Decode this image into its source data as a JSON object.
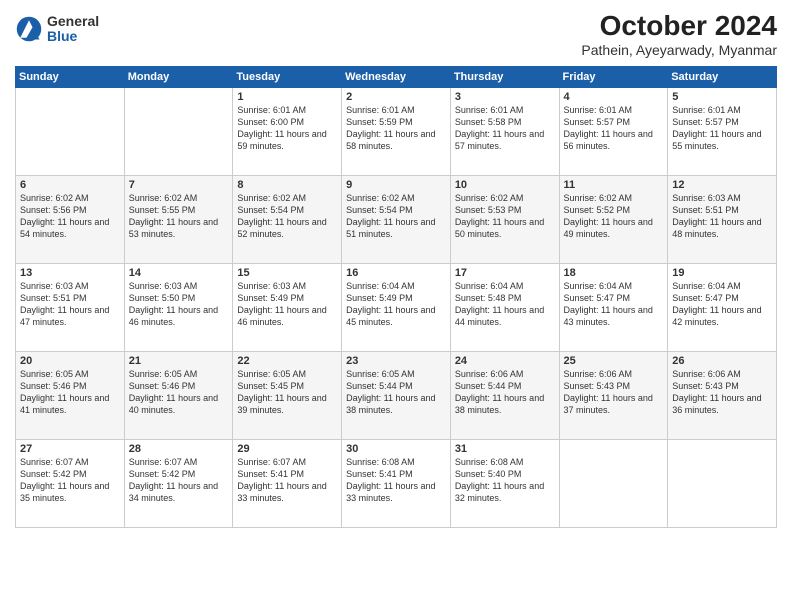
{
  "header": {
    "logo": {
      "general": "General",
      "blue": "Blue"
    },
    "title": "October 2024",
    "subtitle": "Pathein, Ayeyarwady, Myanmar"
  },
  "weekdays": [
    "Sunday",
    "Monday",
    "Tuesday",
    "Wednesday",
    "Thursday",
    "Friday",
    "Saturday"
  ],
  "weeks": [
    [
      {
        "day": "",
        "info": ""
      },
      {
        "day": "",
        "info": ""
      },
      {
        "day": "1",
        "info": "Sunrise: 6:01 AM\nSunset: 6:00 PM\nDaylight: 11 hours and 59 minutes."
      },
      {
        "day": "2",
        "info": "Sunrise: 6:01 AM\nSunset: 5:59 PM\nDaylight: 11 hours and 58 minutes."
      },
      {
        "day": "3",
        "info": "Sunrise: 6:01 AM\nSunset: 5:58 PM\nDaylight: 11 hours and 57 minutes."
      },
      {
        "day": "4",
        "info": "Sunrise: 6:01 AM\nSunset: 5:57 PM\nDaylight: 11 hours and 56 minutes."
      },
      {
        "day": "5",
        "info": "Sunrise: 6:01 AM\nSunset: 5:57 PM\nDaylight: 11 hours and 55 minutes."
      }
    ],
    [
      {
        "day": "6",
        "info": "Sunrise: 6:02 AM\nSunset: 5:56 PM\nDaylight: 11 hours and 54 minutes."
      },
      {
        "day": "7",
        "info": "Sunrise: 6:02 AM\nSunset: 5:55 PM\nDaylight: 11 hours and 53 minutes."
      },
      {
        "day": "8",
        "info": "Sunrise: 6:02 AM\nSunset: 5:54 PM\nDaylight: 11 hours and 52 minutes."
      },
      {
        "day": "9",
        "info": "Sunrise: 6:02 AM\nSunset: 5:54 PM\nDaylight: 11 hours and 51 minutes."
      },
      {
        "day": "10",
        "info": "Sunrise: 6:02 AM\nSunset: 5:53 PM\nDaylight: 11 hours and 50 minutes."
      },
      {
        "day": "11",
        "info": "Sunrise: 6:02 AM\nSunset: 5:52 PM\nDaylight: 11 hours and 49 minutes."
      },
      {
        "day": "12",
        "info": "Sunrise: 6:03 AM\nSunset: 5:51 PM\nDaylight: 11 hours and 48 minutes."
      }
    ],
    [
      {
        "day": "13",
        "info": "Sunrise: 6:03 AM\nSunset: 5:51 PM\nDaylight: 11 hours and 47 minutes."
      },
      {
        "day": "14",
        "info": "Sunrise: 6:03 AM\nSunset: 5:50 PM\nDaylight: 11 hours and 46 minutes."
      },
      {
        "day": "15",
        "info": "Sunrise: 6:03 AM\nSunset: 5:49 PM\nDaylight: 11 hours and 46 minutes."
      },
      {
        "day": "16",
        "info": "Sunrise: 6:04 AM\nSunset: 5:49 PM\nDaylight: 11 hours and 45 minutes."
      },
      {
        "day": "17",
        "info": "Sunrise: 6:04 AM\nSunset: 5:48 PM\nDaylight: 11 hours and 44 minutes."
      },
      {
        "day": "18",
        "info": "Sunrise: 6:04 AM\nSunset: 5:47 PM\nDaylight: 11 hours and 43 minutes."
      },
      {
        "day": "19",
        "info": "Sunrise: 6:04 AM\nSunset: 5:47 PM\nDaylight: 11 hours and 42 minutes."
      }
    ],
    [
      {
        "day": "20",
        "info": "Sunrise: 6:05 AM\nSunset: 5:46 PM\nDaylight: 11 hours and 41 minutes."
      },
      {
        "day": "21",
        "info": "Sunrise: 6:05 AM\nSunset: 5:46 PM\nDaylight: 11 hours and 40 minutes."
      },
      {
        "day": "22",
        "info": "Sunrise: 6:05 AM\nSunset: 5:45 PM\nDaylight: 11 hours and 39 minutes."
      },
      {
        "day": "23",
        "info": "Sunrise: 6:05 AM\nSunset: 5:44 PM\nDaylight: 11 hours and 38 minutes."
      },
      {
        "day": "24",
        "info": "Sunrise: 6:06 AM\nSunset: 5:44 PM\nDaylight: 11 hours and 38 minutes."
      },
      {
        "day": "25",
        "info": "Sunrise: 6:06 AM\nSunset: 5:43 PM\nDaylight: 11 hours and 37 minutes."
      },
      {
        "day": "26",
        "info": "Sunrise: 6:06 AM\nSunset: 5:43 PM\nDaylight: 11 hours and 36 minutes."
      }
    ],
    [
      {
        "day": "27",
        "info": "Sunrise: 6:07 AM\nSunset: 5:42 PM\nDaylight: 11 hours and 35 minutes."
      },
      {
        "day": "28",
        "info": "Sunrise: 6:07 AM\nSunset: 5:42 PM\nDaylight: 11 hours and 34 minutes."
      },
      {
        "day": "29",
        "info": "Sunrise: 6:07 AM\nSunset: 5:41 PM\nDaylight: 11 hours and 33 minutes."
      },
      {
        "day": "30",
        "info": "Sunrise: 6:08 AM\nSunset: 5:41 PM\nDaylight: 11 hours and 33 minutes."
      },
      {
        "day": "31",
        "info": "Sunrise: 6:08 AM\nSunset: 5:40 PM\nDaylight: 11 hours and 32 minutes."
      },
      {
        "day": "",
        "info": ""
      },
      {
        "day": "",
        "info": ""
      }
    ]
  ]
}
